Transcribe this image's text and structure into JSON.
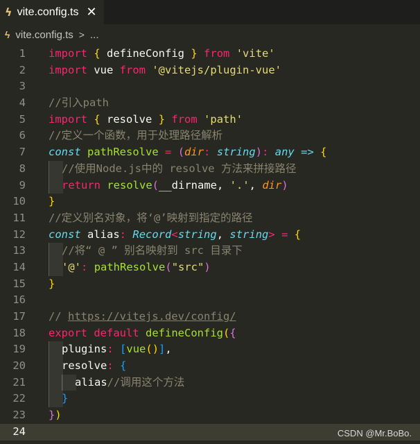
{
  "tab": {
    "icon": "typescript-lightning-icon",
    "label": "vite.config.ts",
    "close": "✕"
  },
  "breadcrumb": {
    "icon": "typescript-lightning-icon",
    "file": "vite.config.ts",
    "separator": ">",
    "rest": "..."
  },
  "watermark": "CSDN @Mr.BoBo.",
  "current_line": 24,
  "lines": [
    {
      "n": 1,
      "indent": 0,
      "tokens": [
        [
          "k",
          "import"
        ],
        [
          "w",
          " "
        ],
        [
          "by",
          "{"
        ],
        [
          "w",
          " defineConfig "
        ],
        [
          "by",
          "}"
        ],
        [
          "w",
          " "
        ],
        [
          "k",
          "from"
        ],
        [
          "w",
          " "
        ],
        [
          "s",
          "'vite'"
        ]
      ]
    },
    {
      "n": 2,
      "indent": 0,
      "tokens": [
        [
          "k",
          "import"
        ],
        [
          "w",
          " vue "
        ],
        [
          "k",
          "from"
        ],
        [
          "w",
          " "
        ],
        [
          "s",
          "'@vitejs/plugin-vue'"
        ]
      ]
    },
    {
      "n": 3,
      "indent": 0,
      "tokens": []
    },
    {
      "n": 4,
      "indent": 0,
      "tokens": [
        [
          "c",
          "//引入path"
        ]
      ]
    },
    {
      "n": 5,
      "indent": 0,
      "tokens": [
        [
          "k",
          "import"
        ],
        [
          "w",
          " "
        ],
        [
          "by",
          "{"
        ],
        [
          "w",
          " resolve "
        ],
        [
          "by",
          "}"
        ],
        [
          "w",
          " "
        ],
        [
          "k",
          "from"
        ],
        [
          "w",
          " "
        ],
        [
          "s",
          "'path'"
        ]
      ]
    },
    {
      "n": 6,
      "indent": 0,
      "tokens": [
        [
          "c",
          "//定义一个函数，用于处理路径解析"
        ]
      ]
    },
    {
      "n": 7,
      "indent": 0,
      "tokens": [
        [
          "t",
          "const"
        ],
        [
          "w",
          " "
        ],
        [
          "f",
          "pathResolve"
        ],
        [
          "w",
          " "
        ],
        [
          "k",
          "="
        ],
        [
          "w",
          " "
        ],
        [
          "bm",
          "("
        ],
        [
          "p",
          "dir"
        ],
        [
          "k",
          ":"
        ],
        [
          "w",
          " "
        ],
        [
          "t",
          "string"
        ],
        [
          "bm",
          ")"
        ],
        [
          "k",
          ":"
        ],
        [
          "w",
          " "
        ],
        [
          "t",
          "any"
        ],
        [
          "w",
          " "
        ],
        [
          "t",
          "=>"
        ],
        [
          "w",
          " "
        ],
        [
          "by",
          "{"
        ]
      ]
    },
    {
      "n": 8,
      "indent": 1,
      "tokens": [
        [
          "c",
          "//使用Node.js中的 resolve 方法来拼接路径"
        ]
      ]
    },
    {
      "n": 9,
      "indent": 1,
      "tokens": [
        [
          "k",
          "return"
        ],
        [
          "w",
          " "
        ],
        [
          "f",
          "resolve"
        ],
        [
          "bm",
          "("
        ],
        [
          "w",
          "__dirname, "
        ],
        [
          "s",
          "'.'"
        ],
        [
          "w",
          ", "
        ],
        [
          "p",
          "dir"
        ],
        [
          "bm",
          ")"
        ]
      ]
    },
    {
      "n": 10,
      "indent": 0,
      "tokens": [
        [
          "by",
          "}"
        ]
      ]
    },
    {
      "n": 11,
      "indent": 0,
      "tokens": [
        [
          "c",
          "//定义别名对象，将‘@’映射到指定的路径"
        ]
      ]
    },
    {
      "n": 12,
      "indent": 0,
      "tokens": [
        [
          "t",
          "const"
        ],
        [
          "w",
          " alias"
        ],
        [
          "k",
          ":"
        ],
        [
          "w",
          " "
        ],
        [
          "t",
          "Record"
        ],
        [
          "k",
          "<"
        ],
        [
          "t",
          "string"
        ],
        [
          "w",
          ", "
        ],
        [
          "t",
          "string"
        ],
        [
          "k",
          ">"
        ],
        [
          "w",
          " "
        ],
        [
          "k",
          "="
        ],
        [
          "w",
          " "
        ],
        [
          "by",
          "{"
        ]
      ]
    },
    {
      "n": 13,
      "indent": 1,
      "tokens": [
        [
          "c",
          "//将“ @ ” 别名映射到 src 目录下"
        ]
      ]
    },
    {
      "n": 14,
      "indent": 1,
      "tokens": [
        [
          "s",
          "'@'"
        ],
        [
          "k",
          ":"
        ],
        [
          "w",
          " "
        ],
        [
          "f",
          "pathResolve"
        ],
        [
          "bm",
          "("
        ],
        [
          "s",
          "\"src\""
        ],
        [
          "bm",
          ")"
        ]
      ]
    },
    {
      "n": 15,
      "indent": 0,
      "tokens": [
        [
          "by",
          "}"
        ]
      ]
    },
    {
      "n": 16,
      "indent": 0,
      "tokens": []
    },
    {
      "n": 17,
      "indent": 0,
      "tokens": [
        [
          "c",
          "// "
        ],
        [
          "link",
          "https://vitejs.dev/config/"
        ]
      ]
    },
    {
      "n": 18,
      "indent": 0,
      "tokens": [
        [
          "k",
          "export"
        ],
        [
          "w",
          " "
        ],
        [
          "k",
          "default"
        ],
        [
          "w",
          " "
        ],
        [
          "f",
          "defineConfig"
        ],
        [
          "by",
          "("
        ],
        [
          "bm",
          "{"
        ]
      ]
    },
    {
      "n": 19,
      "indent": 1,
      "tokens": [
        [
          "w",
          "plugins"
        ],
        [
          "k",
          ":"
        ],
        [
          "w",
          " "
        ],
        [
          "bb",
          "["
        ],
        [
          "f",
          "vue"
        ],
        [
          "by",
          "()"
        ],
        [
          "bb",
          "]"
        ],
        [
          "w",
          ","
        ]
      ]
    },
    {
      "n": 20,
      "indent": 1,
      "tokens": [
        [
          "w",
          "resolve"
        ],
        [
          "k",
          ":"
        ],
        [
          "w",
          " "
        ],
        [
          "bb",
          "{"
        ]
      ]
    },
    {
      "n": 21,
      "indent": 2,
      "tokens": [
        [
          "w",
          "alias"
        ],
        [
          "c",
          "//调用这个方法"
        ]
      ]
    },
    {
      "n": 22,
      "indent": 1,
      "tokens": [
        [
          "bb",
          "}"
        ]
      ]
    },
    {
      "n": 23,
      "indent": 0,
      "tokens": [
        [
          "bm",
          "}"
        ],
        [
          "by",
          ")"
        ]
      ]
    },
    {
      "n": 24,
      "indent": 0,
      "tokens": []
    }
  ]
}
